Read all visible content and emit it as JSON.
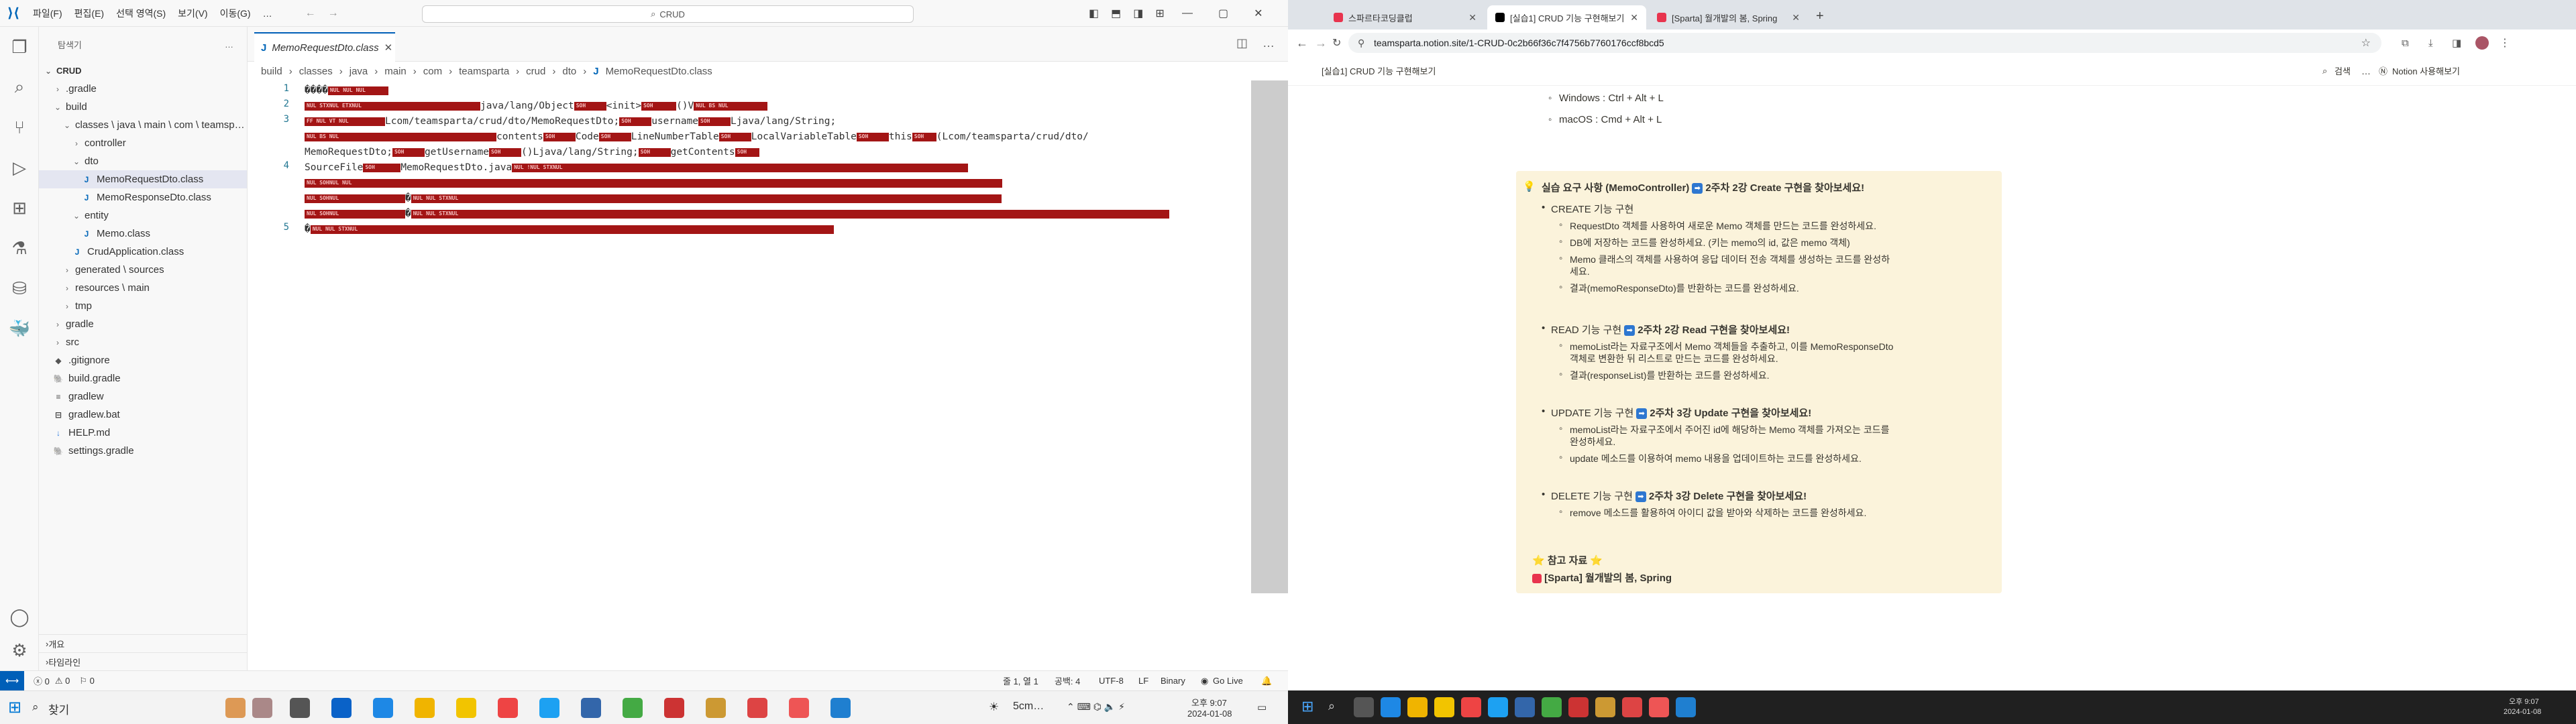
{
  "vscode": {
    "menu": [
      "파일(F)",
      "편집(E)",
      "선택 영역(S)",
      "보기(V)",
      "이동(G)",
      "…"
    ],
    "search": "CRUD",
    "explorer": {
      "title": "탐색기",
      "more": "…",
      "root": "CRUD",
      "items": [
        {
          "label": ".gradle",
          "depth": 1,
          "type": "folder-closed"
        },
        {
          "label": "build",
          "depth": 1,
          "type": "folder-open"
        },
        {
          "label": "classes \\ java \\ main \\ com \\ teamsp…",
          "depth": 2,
          "type": "folder-open"
        },
        {
          "label": "controller",
          "depth": 3,
          "type": "folder-closed"
        },
        {
          "label": "dto",
          "depth": 3,
          "type": "folder-open"
        },
        {
          "label": "MemoRequestDto.class",
          "depth": 4,
          "type": "class",
          "selected": true
        },
        {
          "label": "MemoResponseDto.class",
          "depth": 4,
          "type": "class"
        },
        {
          "label": "entity",
          "depth": 3,
          "type": "folder-open"
        },
        {
          "label": "Memo.class",
          "depth": 4,
          "type": "class"
        },
        {
          "label": "CrudApplication.class",
          "depth": 3,
          "type": "class"
        },
        {
          "label": "generated \\ sources",
          "depth": 2,
          "type": "folder-closed"
        },
        {
          "label": "resources \\ main",
          "depth": 2,
          "type": "folder-closed"
        },
        {
          "label": "tmp",
          "depth": 2,
          "type": "folder-closed"
        },
        {
          "label": "gradle",
          "depth": 1,
          "type": "folder-closed"
        },
        {
          "label": "src",
          "depth": 1,
          "type": "folder-closed"
        },
        {
          "label": ".gitignore",
          "depth": 1,
          "type": "git"
        },
        {
          "label": "build.gradle",
          "depth": 1,
          "type": "gradle"
        },
        {
          "label": "gradlew",
          "depth": 1,
          "type": "file"
        },
        {
          "label": "gradlew.bat",
          "depth": 1,
          "type": "bat"
        },
        {
          "label": "HELP.md",
          "depth": 1,
          "type": "md"
        },
        {
          "label": "settings.gradle",
          "depth": 1,
          "type": "gradle"
        }
      ],
      "outline": "개요",
      "timeline": "타임라인"
    },
    "tab": "MemoRequestDto.class",
    "breadcrumb": [
      "build",
      "classes",
      "java",
      "main",
      "com",
      "teamsparta",
      "crud",
      "dto",
      "MemoRequestDto.class"
    ],
    "code": {
      "line_numbers": [
        "1",
        "2",
        "3",
        "",
        "4",
        "",
        "",
        "",
        "5"
      ],
      "l1_prefix": "����",
      "l2_text": "java/lang/Object",
      "l2_init": "<init>",
      "l2_v": "()V",
      "l3_a": "Lcom/teamsparta/crud/dto/MemoRequestDto;",
      "l3_b": "username",
      "l3_c": "Ljava/lang/String;",
      "l3d_a": "contents",
      "l3d_b": "Code",
      "l3d_c": "LineNumberTable",
      "l3d_d": "LocalVariableTable",
      "l3d_e": "this",
      "l3d_f": "(Lcom/teamsparta/crud/dto/",
      "l3e_a": "MemoRequestDto;",
      "l3e_b": "getUsername",
      "l3e_c": "()Ljava/lang/String;",
      "l3e_d": "getContents",
      "l4_a": "SourceFile",
      "l4_b": "MemoRequestDto.java",
      "l4_q": "�",
      "l5_q": "�"
    },
    "status": {
      "remote": "⟷",
      "errors": "ⓧ 0",
      "warnings": "⚠ 0",
      "info": "⚐ 0",
      "position": "줄 1, 열 1",
      "spaces": "공백: 4",
      "encoding": "UTF-8",
      "eol": "LF",
      "mode": "Binary",
      "golive": "Go Live"
    }
  },
  "chrome": {
    "tabs": [
      {
        "title": "스파르타코딩클럽",
        "color": "#e8344e"
      },
      {
        "title": "[실습1] CRUD 기능 구현해보기",
        "color": "#000000",
        "active": true
      },
      {
        "title": "[Sparta] 월개발의 봄, Spring",
        "color": "#e8344e"
      }
    ],
    "url": "teamsparta.notion.site/1-CRUD-0c2b66f36c7f4756b7760176ccf8bcd5",
    "page_title": "[실습1] CRUD 기능 구현해보기",
    "search_label": "검색",
    "notion_label": "Notion 사용해보기",
    "list_top": [
      "Windows : Ctrl + Alt + L",
      "macOS : Cmd + Alt + L"
    ],
    "callout": {
      "title_pre": "실습 요구 사항 (MemoController)",
      "title_post": "2주차 2강 Create 구현을 찾아보세요!",
      "create": "CREATE 기능 구현",
      "create_items": [
        "RequestDto 객체를 사용하여 새로운 Memo 객체를 만드는 코드를 완성하세요.",
        "DB에 저장하는 코드를 완성하세요. (키는 memo의 id, 값은 memo 객체)",
        "Memo 클래스의 객체를 사용하여 응답 데이터 전송 객체를 생성하는 코드를 완성하",
        "세요.",
        "결과(memoResponseDto)를 반환하는 코드를 완성하세요."
      ],
      "read": "READ 기능 구현",
      "read_post": "2주차 2강 Read 구현을 찾아보세요!",
      "read_items": [
        "memoList라는 자료구조에서 Memo 객체들을 추출하고, 이를 MemoResponseDto",
        "객체로 변환한 뒤 리스트로 만드는 코드를 완성하세요.",
        "결과(responseList)를 반환하는 코드를 완성하세요."
      ],
      "update": "UPDATE 기능 구현",
      "update_post": "2주차 3강 Update 구현을 찾아보세요!",
      "update_items": [
        "memoList라는 자료구조에서 주어진 id에 해당하는 Memo 객체를 가져오는 코드를",
        "완성하세요.",
        "update 메소드를 이용하여 memo 내용을 업데이트하는 코드를 완성하세요."
      ],
      "delete": "DELETE 기능 구현",
      "delete_post": "2주차 3강 Delete 구현을 찾아보세요!",
      "delete_items": [
        "remove 메소드를 활용하여 아이디 값을 받아와 삭제하는 코드를 완성하세요."
      ],
      "ref_title": "참고 자료",
      "ref_link": "[Sparta] 월개발의 봄, Spring"
    }
  },
  "taskbar": {
    "search": "찾기",
    "weather": "5cm…",
    "time1": "오후 9:07",
    "date1": "2024-01-08",
    "time2": "오후 9:07",
    "date2": "2024-01-08"
  }
}
